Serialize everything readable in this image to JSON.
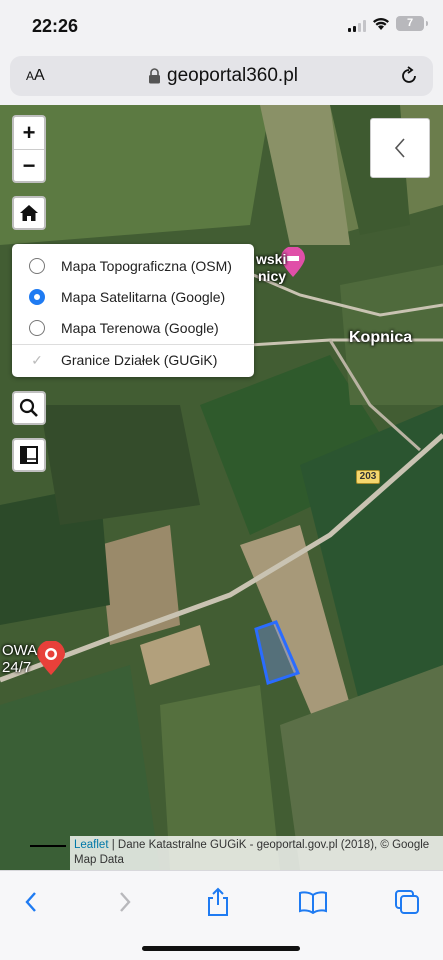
{
  "status_bar": {
    "time": "22:26",
    "battery": "7"
  },
  "browser": {
    "text_size_small": "A",
    "text_size_large": "A",
    "url": "geoportal360.pl"
  },
  "map_controls": {
    "zoom_in": "+",
    "zoom_out": "−"
  },
  "layers": [
    {
      "label": "Mapa Topograficzna (OSM)",
      "type": "radio",
      "selected": false
    },
    {
      "label": "Mapa Satelitarna (Google)",
      "type": "radio",
      "selected": true
    },
    {
      "label": "Mapa Terenowa (Google)",
      "type": "radio",
      "selected": false
    },
    {
      "label": "Granice Działek (GUGiK)",
      "type": "checkbox",
      "selected": true
    }
  ],
  "map_labels": {
    "town": "Kopnica",
    "road": "203",
    "poi_partial_1": "wski",
    "poi_partial_2": "nicy",
    "left_partial_1": "OWA",
    "left_partial_2": "24/7"
  },
  "attribution": {
    "leaflet": "Leaflet",
    "rest": " | Dane Katastralne GUGiK - geoportal.gov.pl (2018), © Google Map Data"
  },
  "colors": {
    "accent": "#1f7bf2",
    "marker_red": "#e8403a",
    "poi_pink": "#e04fa8",
    "parcel": "#2a6cff"
  },
  "icons": [
    "lock-icon",
    "reload-icon",
    "home-icon",
    "search-icon",
    "ruler-icon",
    "chevron-left-icon",
    "back-icon",
    "forward-icon",
    "share-icon",
    "bookmarks-icon",
    "tabs-icon"
  ]
}
